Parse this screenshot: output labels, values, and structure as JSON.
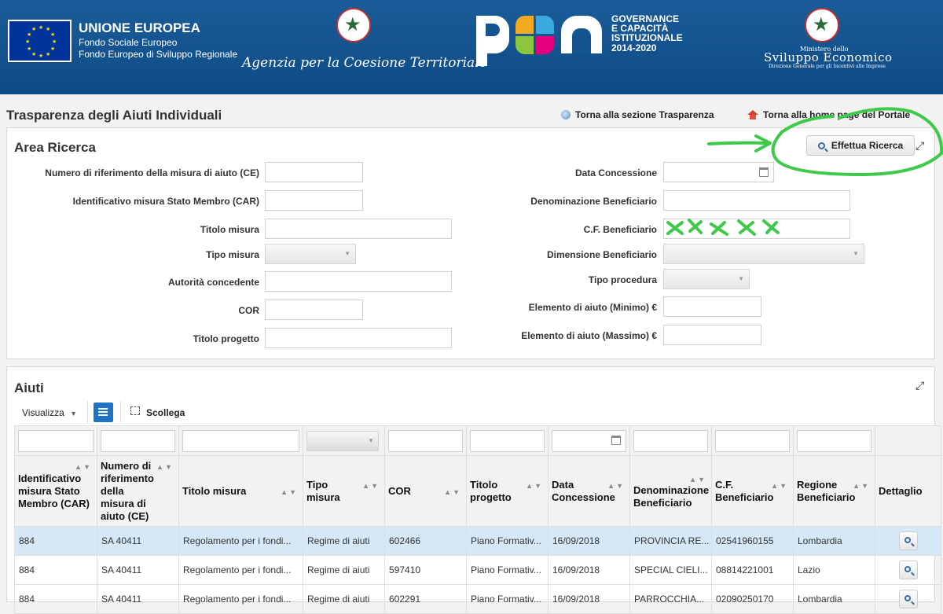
{
  "banner": {
    "eu_title": "UNIONE EUROPEA",
    "eu_line1": "Fondo Sociale Europeo",
    "eu_line2": "Fondo Europeo di Sviluppo Regionale",
    "agency": "Agenzia per la Coesione Territoriale",
    "pon_line1": "GOVERNANCE",
    "pon_line2": "E CAPACITÀ",
    "pon_line3": "ISTITUZIONALE",
    "pon_line4": "2014-2020",
    "mise_line1": "Ministero dello",
    "mise_line2": "Sviluppo Economico",
    "mise_line3": "Direzione Generale per gli Incentivi alle Imprese"
  },
  "header": {
    "title": "Trasparenza degli Aiuti Individuali",
    "link_trasparenza": "Torna alla sezione Trasparenza",
    "link_portale": "Torna alla home page del Portale"
  },
  "search": {
    "title": "Area Ricerca",
    "button": "Effettua Ricerca",
    "labels": {
      "numero_ce": "Numero di riferimento della misura di aiuto (CE)",
      "car": "Identificativo misura Stato Membro (CAR)",
      "titolo_misura": "Titolo misura",
      "tipo_misura": "Tipo misura",
      "autorita": "Autorità concedente",
      "cor": "COR",
      "titolo_progetto": "Titolo progetto",
      "data_concessione": "Data Concessione",
      "denominazione": "Denominazione Beneficiario",
      "cf": "C.F. Beneficiario",
      "dimensione": "Dimensione Beneficiario",
      "tipo_procedura": "Tipo procedura",
      "elem_min": "Elemento di aiuto (Minimo) €",
      "elem_max": "Elemento di aiuto (Massimo) €"
    }
  },
  "results": {
    "title": "Aiuti",
    "view_menu": "Visualizza",
    "detach": "Scollega",
    "columns": [
      "Identificativo misura Stato Membro (CAR)",
      "Numero di riferimento della misura di aiuto (CE)",
      "Titolo misura",
      "Tipo misura",
      "COR",
      "Titolo progetto",
      "Data Concessione",
      "Denominazione Beneficiario",
      "C.F. Beneficiario",
      "Regione Beneficiario",
      "Dettaglio"
    ],
    "rows": [
      [
        "884",
        "SA 40411",
        "Regolamento per i fondi...",
        "Regime di aiuti",
        "602466",
        "Piano Formativ...",
        "16/09/2018",
        "PROVINCIA RE...",
        "02541960155",
        "Lombardia"
      ],
      [
        "884",
        "SA 40411",
        "Regolamento per i fondi...",
        "Regime di aiuti",
        "597410",
        "Piano Formativ...",
        "16/09/2018",
        "SPECIAL CIELI...",
        "08814221001",
        "Lazio"
      ],
      [
        "884",
        "SA 40411",
        "Regolamento per i fondi...",
        "Regime di aiuti",
        "602291",
        "Piano Formativ...",
        "16/09/2018",
        "PARROCCHIA...",
        "02090250170",
        "Lombardia"
      ]
    ]
  },
  "colors": {
    "banner": "#14548f",
    "annotation": "#3ec94a",
    "selected_row": "#d6e8f8"
  }
}
